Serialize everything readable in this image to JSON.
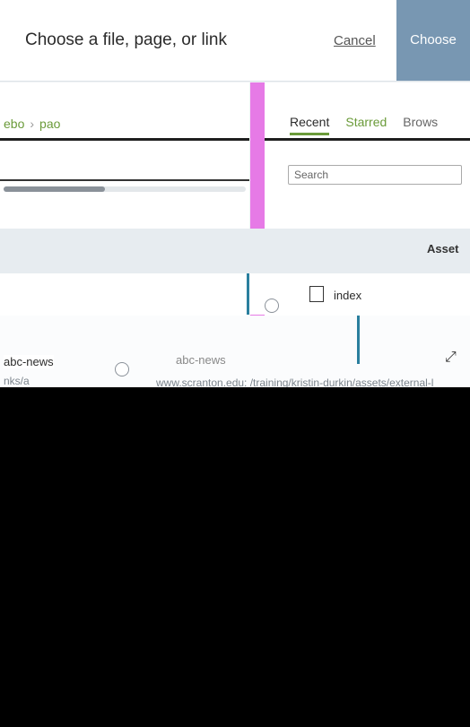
{
  "header": {
    "title": "Choose a file, page, or link",
    "cancel_label": "Cancel",
    "choose_label": "Choose"
  },
  "left_panel": {
    "breadcrumb": [
      "ebo",
      "pao"
    ],
    "progress": 0.42
  },
  "tabs": [
    {
      "label": "Recent",
      "active": true
    },
    {
      "label": "Starred",
      "active": false
    },
    {
      "label": "Brows",
      "active": false
    }
  ],
  "search": {
    "placeholder": "Search"
  },
  "list": {
    "column_header": "Asset",
    "rows": [
      {
        "label": "index",
        "path": ""
      },
      {
        "label": "abc-news",
        "path": "www.scranton.edu: /training/kristin-durkin/assets/external-l"
      }
    ],
    "left_label_row2": "abc-news",
    "left_path_row2": "nks/a"
  }
}
